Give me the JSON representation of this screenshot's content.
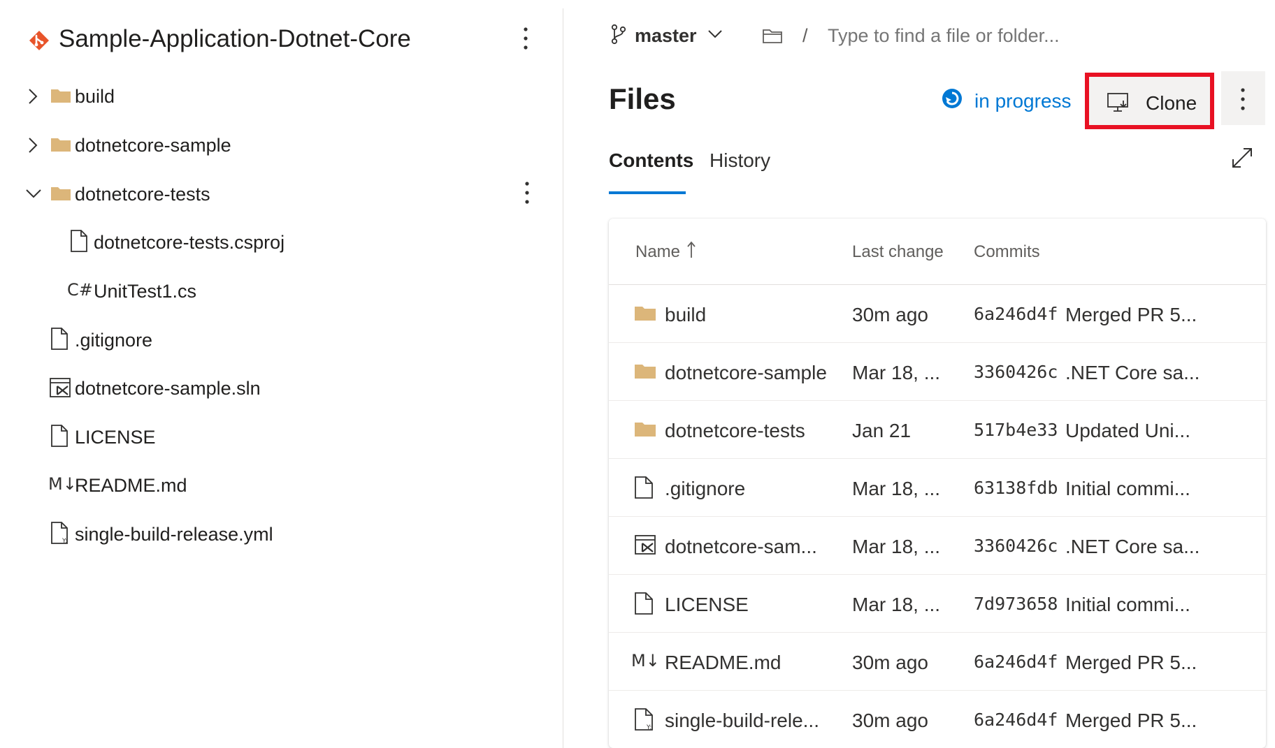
{
  "repo": {
    "name": "Sample-Application-Dotnet-Core",
    "logo_icon": "azure-repos-icon",
    "accent": "#e8542a"
  },
  "tree": [
    {
      "label": "build",
      "icon": "folder-icon",
      "chevron": "right"
    },
    {
      "label": "dotnetcore-sample",
      "icon": "folder-icon",
      "chevron": "right"
    },
    {
      "label": "dotnetcore-tests",
      "icon": "folder-icon",
      "chevron": "down"
    },
    {
      "label": "dotnetcore-tests.csproj",
      "icon": "file-icon"
    },
    {
      "label": "UnitTest1.cs",
      "icon": "csharp-icon",
      "glyph": "C#"
    },
    {
      "label": ".gitignore",
      "icon": "file-icon"
    },
    {
      "label": "dotnetcore-sample.sln",
      "icon": "visual-studio-solution-icon"
    },
    {
      "label": "LICENSE",
      "icon": "file-icon"
    },
    {
      "label": "README.md",
      "icon": "markdown-icon",
      "glyph": "M↓"
    },
    {
      "label": "single-build-release.yml",
      "icon": "yaml-file-icon"
    }
  ],
  "topbar": {
    "branch": "master",
    "path_separator": "/",
    "search_placeholder": "Type to find a file or folder..."
  },
  "main": {
    "title": "Files",
    "status": "in progress",
    "clone_label": "Clone",
    "tabs": [
      {
        "label": "Contents",
        "active": true
      },
      {
        "label": "History",
        "active": false
      }
    ]
  },
  "table": {
    "headers": {
      "name": "Name",
      "last_change": "Last change",
      "commits": "Commits"
    },
    "rows": [
      {
        "icon": "folder-icon",
        "name": "build",
        "last_change": "30m ago",
        "hash": "6a246d4f",
        "message": "Merged PR 5..."
      },
      {
        "icon": "folder-icon",
        "name": "dotnetcore-sample",
        "last_change": "Mar 18, ...",
        "hash": "3360426c",
        "message": ".NET Core sa..."
      },
      {
        "icon": "folder-icon",
        "name": "dotnetcore-tests",
        "last_change": "Jan 21",
        "hash": "517b4e33",
        "message": "Updated Uni..."
      },
      {
        "icon": "file-icon",
        "name": ".gitignore",
        "last_change": "Mar 18, ...",
        "hash": "63138fdb",
        "message": "Initial commi..."
      },
      {
        "icon": "visual-studio-solution-icon",
        "name": "dotnetcore-sam...",
        "last_change": "Mar 18, ...",
        "hash": "3360426c",
        "message": ".NET Core sa..."
      },
      {
        "icon": "file-icon",
        "name": "LICENSE",
        "last_change": "Mar 18, ...",
        "hash": "7d973658",
        "message": "Initial commi..."
      },
      {
        "icon": "markdown-icon",
        "glyph": "M↓",
        "name": "README.md",
        "last_change": "30m ago",
        "hash": "6a246d4f",
        "message": "Merged PR 5..."
      },
      {
        "icon": "yaml-file-icon",
        "name": "single-build-rele...",
        "last_change": "30m ago",
        "hash": "6a246d4f",
        "message": "Merged PR 5..."
      }
    ]
  },
  "colors": {
    "accent_blue": "#0078d4",
    "folder": "#dcb67a",
    "highlight_red": "#e81123",
    "repo_logo": "#e8542a"
  }
}
